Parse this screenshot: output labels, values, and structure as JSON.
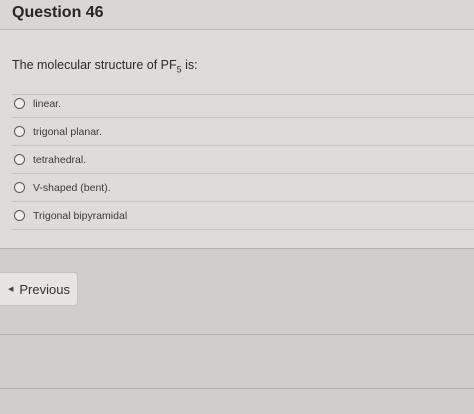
{
  "header": {
    "title": "Question 46"
  },
  "question": {
    "prompt_main": "The molecular structure of PF",
    "prompt_sub": "5",
    "prompt_end": " is:"
  },
  "options": [
    {
      "label": "linear."
    },
    {
      "label": "trigonal planar."
    },
    {
      "label": "tetrahedral."
    },
    {
      "label": "V-shaped (bent)."
    },
    {
      "label": "Trigonal bipyramidal"
    }
  ],
  "navigation": {
    "previous_label": "Previous",
    "previous_icon": "chevron-left-icon"
  }
}
